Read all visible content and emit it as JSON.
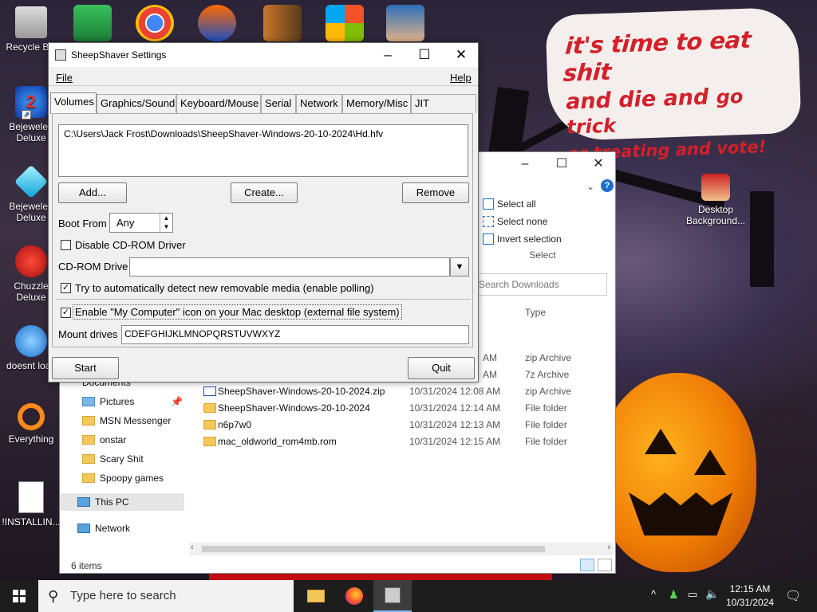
{
  "desktop": {
    "icons_left": [
      {
        "label": "Recycle Bin",
        "icon": "recycle-bin-icon"
      },
      {
        "label": "Bejeweled Deluxe",
        "icon": "bejeweled-twist-icon"
      },
      {
        "label": "Bejeweled Deluxe",
        "icon": "diamond-icon"
      },
      {
        "label": "Chuzzle Deluxe",
        "icon": "chuzzle-icon"
      },
      {
        "label": "doesnt load",
        "icon": "bird-icon"
      },
      {
        "label": "Everything",
        "icon": "magnifier-icon"
      },
      {
        "label": "!INSTALLIN...",
        "icon": "text-file-icon"
      }
    ],
    "icon_right": {
      "label": "Desktop Background...",
      "icon": "character-icon"
    },
    "speech_bubble": {
      "line1": "it's time to eat shit",
      "line2a": "and die and",
      "line2b": "go trick",
      "line3": "or treating and vote!"
    }
  },
  "explorer": {
    "ribbon": {
      "select_all": "Select all",
      "select_none": "Select none",
      "invert_selection": "Invert selection",
      "group_label": "Select"
    },
    "search_placeholder": "Search Downloads",
    "column_type": "Type",
    "nav": [
      {
        "label": "Documents",
        "pinned": true
      },
      {
        "label": "Pictures",
        "pinned": true
      },
      {
        "label": "MSN Messenger"
      },
      {
        "label": "onstar"
      },
      {
        "label": "Scary Shit"
      },
      {
        "label": "Spoopy games"
      }
    ],
    "this_pc": "This PC",
    "network": "Network",
    "partial_rows": [
      {
        "time": "AM",
        "type": "zip Archive"
      },
      {
        "time": "AM",
        "type": "7z Archive"
      }
    ],
    "files": [
      {
        "name": "SheepShaver-Windows-20-10-2024.zip",
        "date": "10/31/2024 12:08 AM",
        "type": "zip Archive",
        "icon": "zip-icon"
      },
      {
        "name": "SheepShaver-Windows-20-10-2024",
        "date": "10/31/2024 12:14 AM",
        "type": "File folder",
        "icon": "folder-icon"
      },
      {
        "name": "n6p7w0",
        "date": "10/31/2024 12:13 AM",
        "type": "File folder",
        "icon": "folder-icon"
      },
      {
        "name": "mac_oldworld_rom4mb.rom",
        "date": "10/31/2024 12:15 AM",
        "type": "File folder",
        "icon": "folder-icon"
      }
    ],
    "status": "6 items"
  },
  "dialog": {
    "title": "SheepShaver Settings",
    "menu": {
      "file": "File",
      "help": "Help"
    },
    "tabs": [
      "Volumes",
      "Graphics/Sound",
      "Keyboard/Mouse",
      "Serial",
      "Network",
      "Memory/Misc",
      "JIT Compiler"
    ],
    "volume_path": "C:\\Users\\Jack Frost\\Downloads\\SheepShaver-Windows-20-10-2024\\Hd.hfv",
    "add": "Add...",
    "create": "Create...",
    "remove": "Remove",
    "boot_from_label": "Boot From",
    "boot_from_value": "Any",
    "disable_cdrom": "Disable CD-ROM Driver",
    "cdrom_drive_label": "CD-ROM Drive",
    "cdrom_drive_value": "",
    "auto_detect": "Try to automatically detect new removable media (enable polling)",
    "my_computer": "Enable \"My Computer\" icon on your Mac desktop (external file system)",
    "mount_drives_label": "Mount drives",
    "mount_drives_value": "CDEFGHIJKLMNOPQRSTUVWXYZ",
    "start": "Start",
    "quit": "Quit",
    "disable_cdrom_checked": false,
    "auto_detect_checked": true,
    "my_computer_checked": true
  },
  "taskbar": {
    "search_placeholder": "Type here to search",
    "time": "12:15 AM",
    "date": "10/31/2024"
  },
  "colors": {
    "accent": "#1e6fcc",
    "bubble_text": "#d3202a",
    "taskbar": "#1d1d1d"
  }
}
